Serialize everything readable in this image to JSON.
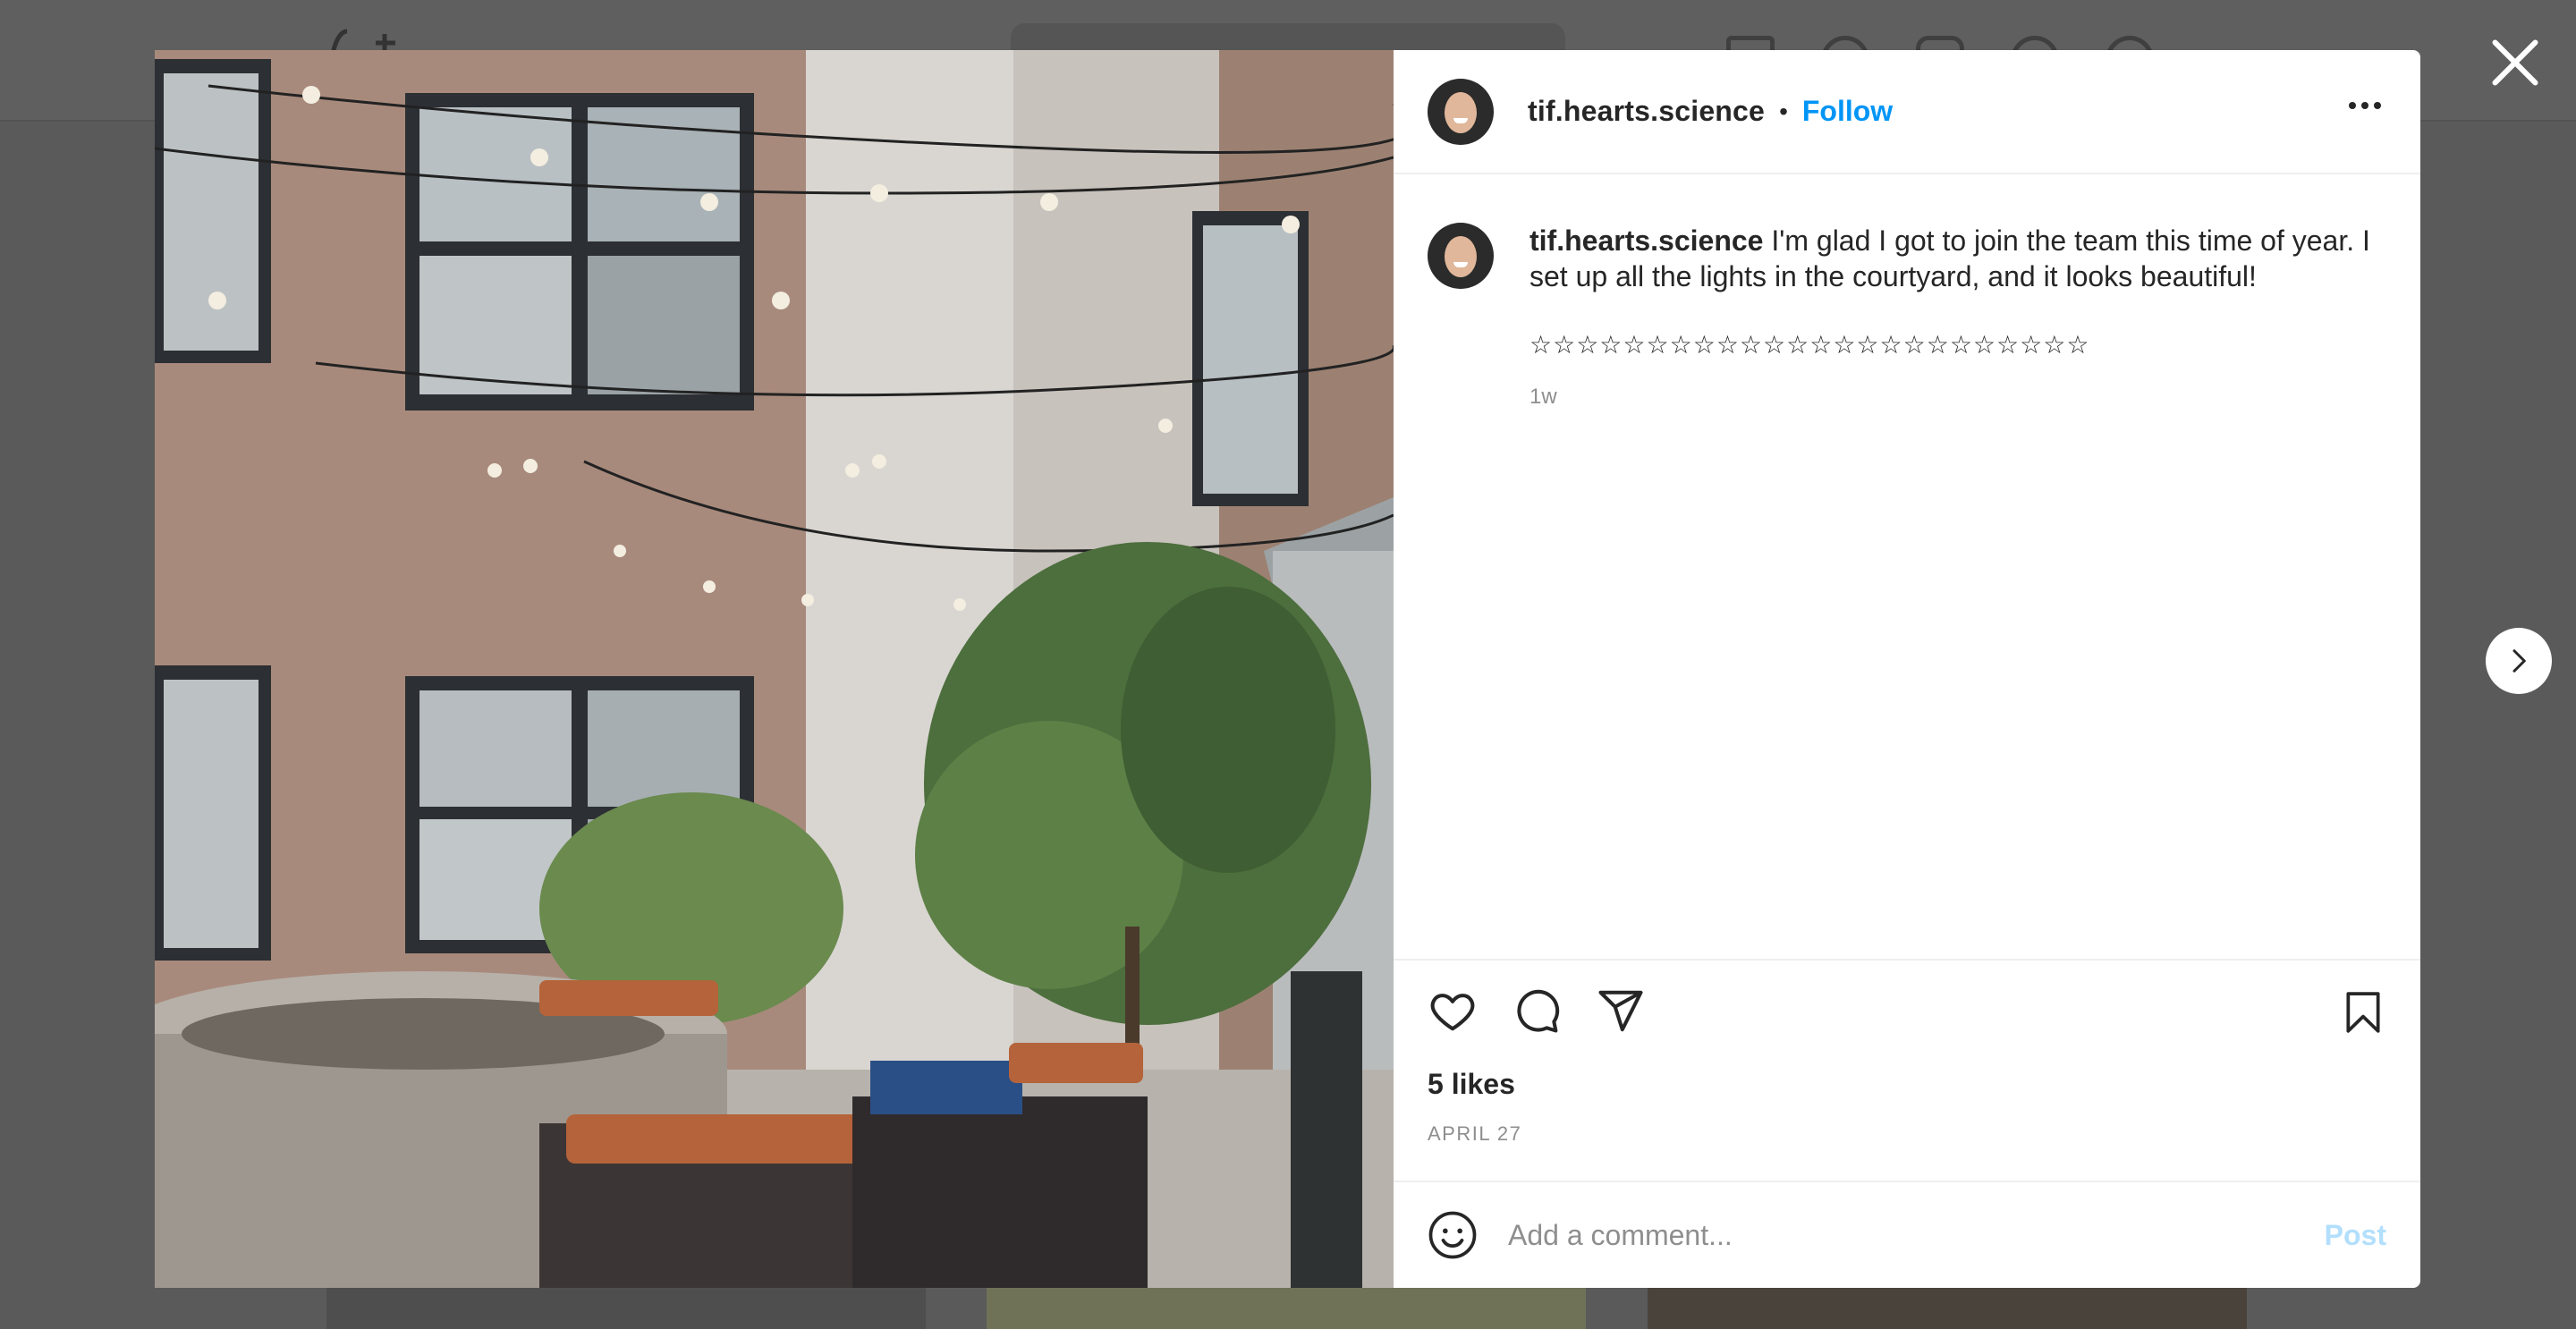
{
  "post": {
    "username": "tif.hearts.science",
    "separator": "•",
    "follow_label": "Follow",
    "caption_text": "I'm glad I got to join the team this time of year. I set up all the lights in the courtyard, and it looks beautiful!",
    "stars": "☆☆☆☆☆☆☆☆☆☆☆☆☆☆☆☆☆☆☆☆☆☆☆☆",
    "time_ago": "1w",
    "likes": "5 likes",
    "date": "APRIL 27"
  },
  "comment_box": {
    "placeholder": "Add a comment...",
    "post_label": "Post"
  },
  "icons": {
    "close": "close-icon",
    "next": "chevron-right-icon",
    "more": "more-options-icon",
    "like": "heart-icon",
    "comment": "comment-icon",
    "share": "share-icon",
    "save": "bookmark-icon",
    "emoji": "emoji-icon"
  },
  "colors": {
    "accent": "#0095f6",
    "post_disabled": "#b2dffc",
    "secondary_text": "#8e8e8e",
    "overlay": "#5a5a5a"
  }
}
